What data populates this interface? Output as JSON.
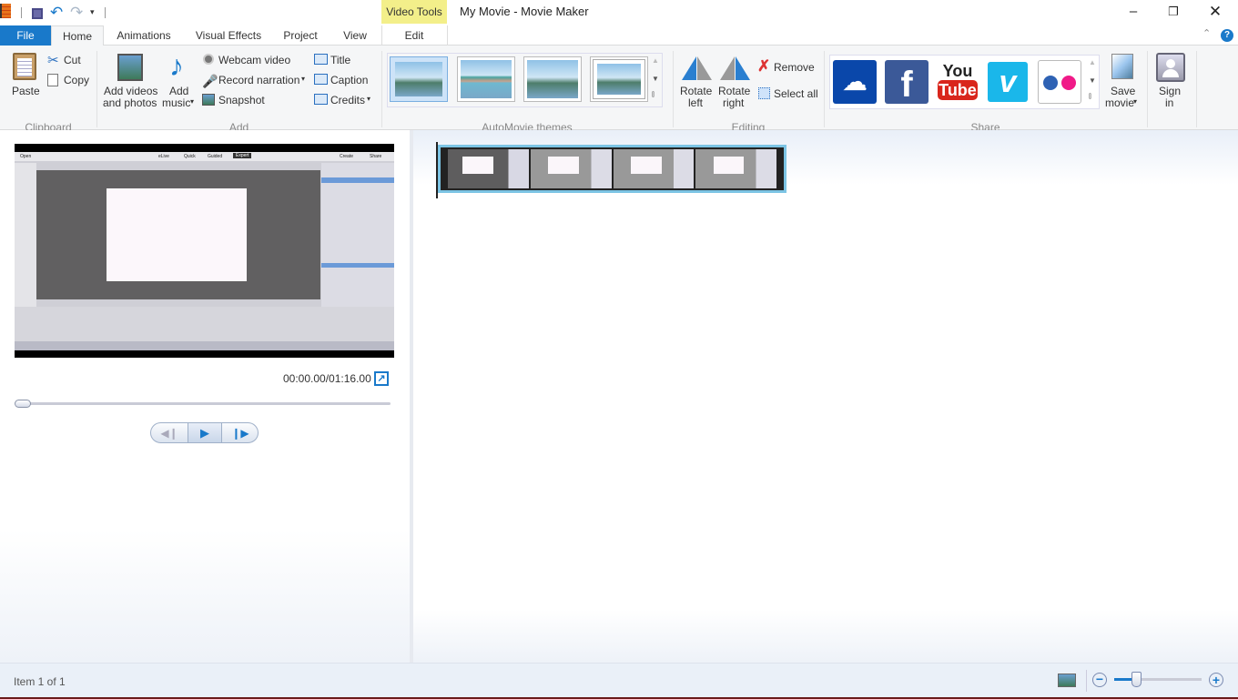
{
  "window": {
    "title": "My Movie - Movie Maker",
    "contextual_tab_group": "Video Tools",
    "accent": "#1979ca",
    "contextual_color": "#f3ef8a"
  },
  "quick_access": [
    {
      "icon": "save-icon"
    },
    {
      "icon": "undo-icon"
    },
    {
      "icon": "redo-icon"
    },
    {
      "icon": "customize-dropdown-icon"
    }
  ],
  "tabs": [
    {
      "label": "File"
    },
    {
      "label": "Home",
      "selected": true
    },
    {
      "label": "Animations"
    },
    {
      "label": "Visual Effects"
    },
    {
      "label": "Project"
    },
    {
      "label": "View"
    },
    {
      "label": "Edit"
    }
  ],
  "ribbon": {
    "clipboard": {
      "label": "Clipboard",
      "paste": "Paste",
      "cut": "Cut",
      "copy": "Copy"
    },
    "add": {
      "label": "Add",
      "add_videos_1": "Add videos",
      "add_videos_2": "and photos",
      "add_music_1": "Add",
      "add_music_2": "music",
      "webcam": "Webcam video",
      "narration": "Record narration",
      "snapshot": "Snapshot",
      "title": "Title",
      "caption": "Caption",
      "credits": "Credits"
    },
    "themes": {
      "label": "AutoMovie themes"
    },
    "editing": {
      "label": "Editing",
      "rotate_left_1": "Rotate",
      "rotate_left_2": "left",
      "rotate_right_1": "Rotate",
      "rotate_right_2": "right",
      "remove": "Remove",
      "select_all": "Select all"
    },
    "share": {
      "label": "Share",
      "services": [
        "OneDrive",
        "Facebook",
        "YouTube",
        "Vimeo",
        "Flickr"
      ],
      "youtube_1": "You",
      "youtube_2": "Tube",
      "save_movie_1": "Save",
      "save_movie_2": "movie"
    },
    "signin": {
      "line1": "Sign",
      "line2": "in"
    }
  },
  "preview": {
    "menu": [
      "Open",
      "eLive",
      "Quick",
      "Guided",
      "Expert",
      "Create",
      "Share"
    ],
    "time": "00:00.00/01:16.00",
    "seek_progress": 0
  },
  "status": {
    "text": "Item 1 of 1",
    "zoom_level": 0.25
  }
}
